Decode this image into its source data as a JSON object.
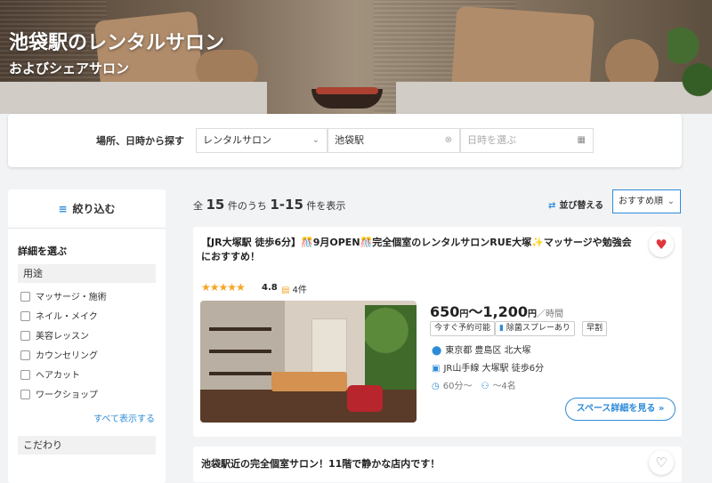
{
  "hero": {
    "title": "池袋駅のレンタルサロン",
    "subtitle": "およびシェアサロン"
  },
  "search": {
    "label": "場所、日時から探す",
    "category_value": "レンタルサロン",
    "location_value": "池袋駅",
    "date_placeholder": "日時を選ぶ"
  },
  "sidebar": {
    "refine_label": "絞り込む",
    "details_heading": "詳細を選ぶ",
    "purpose_heading": "用途",
    "purpose_options": [
      "マッサージ・施術",
      "ネイル・メイク",
      "美容レッスン",
      "カウンセリング",
      "ヘアカット",
      "ワークショップ"
    ],
    "show_all": "すべて表示する",
    "features_heading": "こだわり"
  },
  "results": {
    "count_prefix": "全",
    "total": "15",
    "count_mid": "件のうち",
    "range": "1-15",
    "count_suffix": "件を表示",
    "sort_label": "並び替える",
    "sort_value": "おすすめ順"
  },
  "listings": [
    {
      "title": "【JR大塚駅 徒歩6分】🎊9月OPEN🎊完全個室のレンタルサロンRUE大塚✨マッサージや勉強会におすすめ！",
      "rating": "4.8",
      "stars": "★★★★★",
      "reviews": "4件",
      "price_from": "650",
      "price_to": "1,200",
      "price_unit": "円",
      "price_sep": "〜",
      "price_per": "／時間",
      "tags": [
        "今すぐ予約可能",
        "除菌スプレーあり",
        "早割"
      ],
      "address": "東京都 豊島区 北大塚",
      "access": "JR山手線 大塚駅 徒歩6分",
      "min_time": "60分〜",
      "capacity": "〜4名",
      "detail_button": "スペース詳細を見る",
      "favorited": true
    },
    {
      "title": "池袋駅近の完全個室サロン！11階で静かな店内です！",
      "favorited": false
    }
  ],
  "colors": {
    "accent": "#2e8bd8",
    "heart": "#e0353c",
    "star": "#f5a623"
  }
}
